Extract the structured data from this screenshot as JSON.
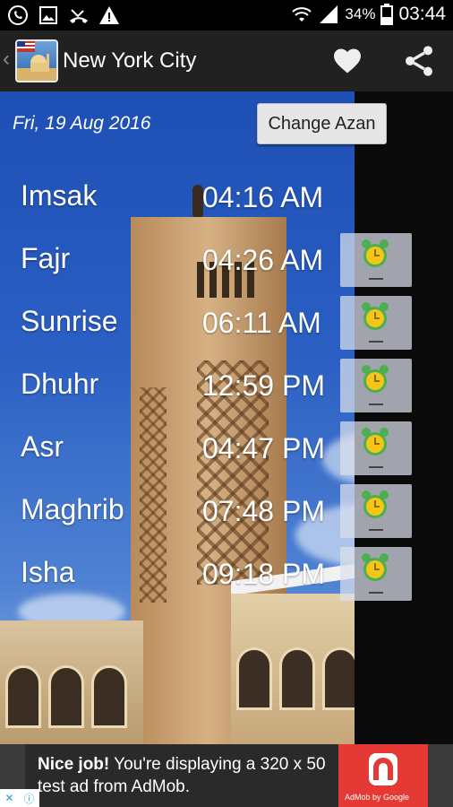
{
  "status_bar": {
    "battery_percent": "34%",
    "time": "03:44",
    "icons": [
      "whatsapp-icon",
      "gallery-icon",
      "missed-call-icon",
      "warning-icon",
      "wifi-icon",
      "signal-icon",
      "battery-icon"
    ]
  },
  "action_bar": {
    "title": "New York City",
    "actions": [
      "heart-icon",
      "share-icon"
    ]
  },
  "header": {
    "date": "Fri, 19 Aug 2016",
    "change_azan_label": "Change Azan"
  },
  "prayers": [
    {
      "name": "Imsak",
      "time": "04:16 AM",
      "has_alarm": false
    },
    {
      "name": "Fajr",
      "time": "04:26 AM",
      "has_alarm": true
    },
    {
      "name": "Sunrise",
      "time": "06:11 AM",
      "has_alarm": true
    },
    {
      "name": "Dhuhr",
      "time": "12:59 PM",
      "has_alarm": true
    },
    {
      "name": "Asr",
      "time": "04:47 PM",
      "has_alarm": true
    },
    {
      "name": "Maghrib",
      "time": "07:48 PM",
      "has_alarm": true
    },
    {
      "name": "Isha",
      "time": "09:18 PM",
      "has_alarm": true
    }
  ],
  "ad": {
    "headline": "Nice job!",
    "body": " You're displaying a 320 x 50 test ad from AdMob.",
    "brand_caption": "AdMob by Google"
  },
  "colors": {
    "action_bar": "#212121",
    "sky": "#2a5fc3",
    "alarm_yellow": "#f5c518",
    "alarm_green": "#4caf50",
    "ad_red": "#e53935"
  }
}
